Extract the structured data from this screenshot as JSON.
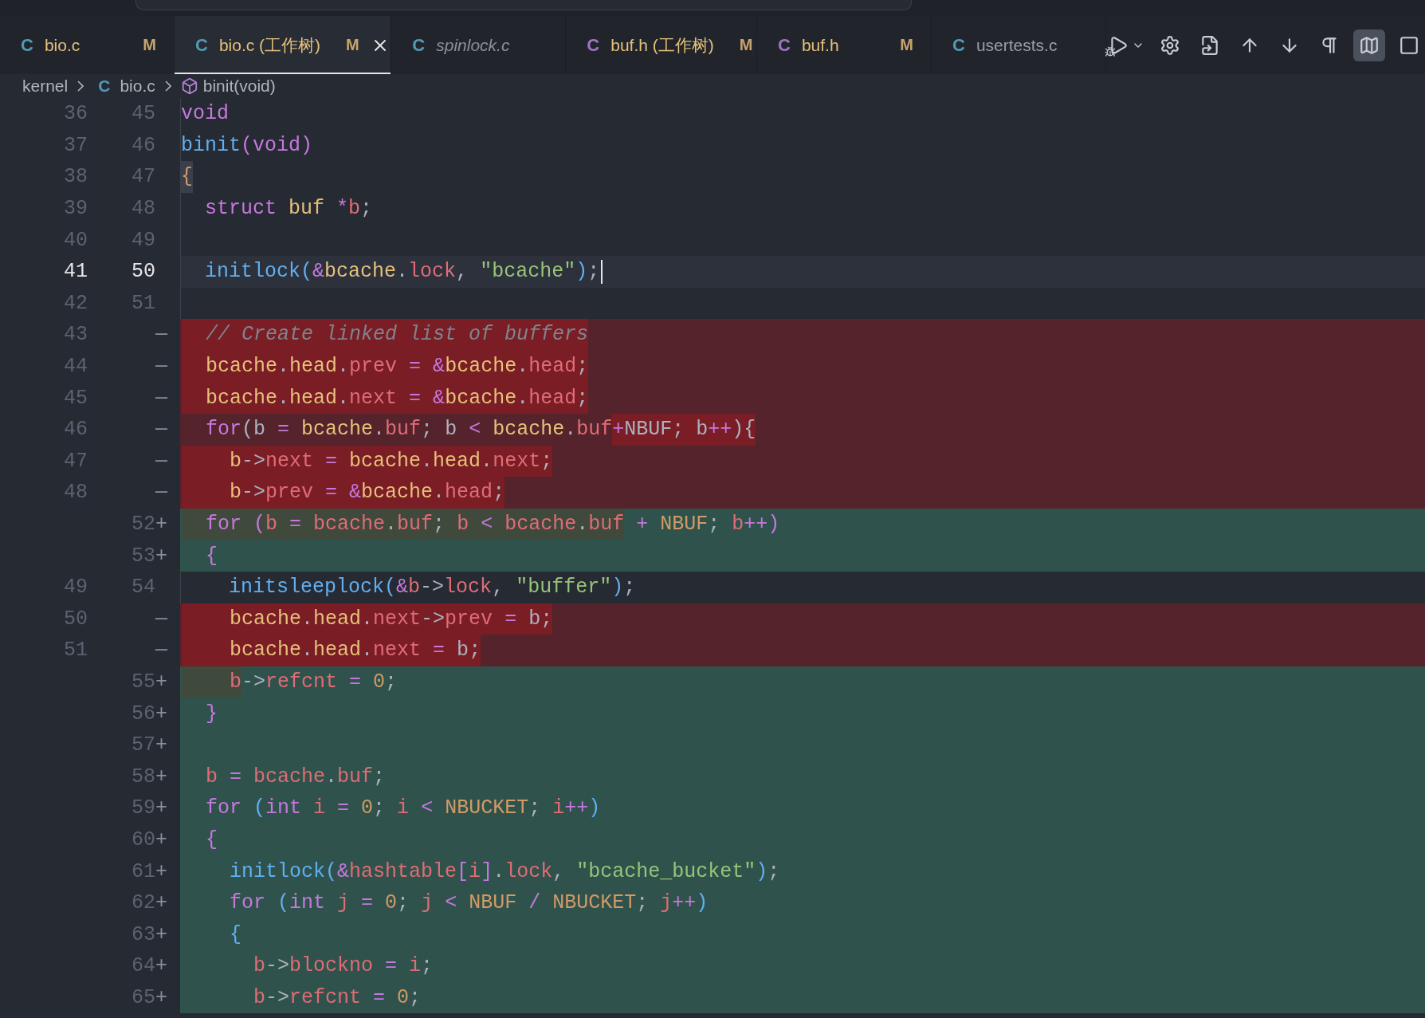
{
  "tabs": [
    {
      "icon": "C",
      "color": "#519aba",
      "label": "bio.c",
      "status": "M",
      "selected": false,
      "preview": false
    },
    {
      "icon": "C",
      "color": "#519aba",
      "label": "bio.c (工作树)",
      "status": "M",
      "selected": true,
      "preview": false
    },
    {
      "icon": "C",
      "color": "#519aba",
      "label": "spinlock.c",
      "selected": false,
      "preview": true
    },
    {
      "icon": "C",
      "color": "#a074c4",
      "label": "buf.h (工作树)",
      "status": "M",
      "selected": false,
      "preview": false
    },
    {
      "icon": "C",
      "color": "#a074c4",
      "label": "buf.h",
      "status": "M",
      "selected": false,
      "preview": false
    },
    {
      "icon": "C",
      "color": "#519aba",
      "label": "usertests.c",
      "selected": false,
      "preview": false
    }
  ],
  "toolbar": [
    {
      "kind": "run",
      "active": false
    },
    {
      "kind": "settings",
      "active": false
    },
    {
      "kind": "open-file",
      "active": false
    },
    {
      "kind": "up",
      "active": false
    },
    {
      "kind": "down",
      "active": false
    },
    {
      "kind": "whitespace",
      "active": false
    },
    {
      "kind": "map",
      "active": true
    },
    {
      "kind": "more",
      "active": false
    }
  ],
  "breadcrumb": [
    {
      "kind": "folder",
      "label": "kernel"
    },
    {
      "kind": "file",
      "icon": "C",
      "label": "bio.c"
    },
    {
      "kind": "symbol",
      "label": "binit(void)"
    }
  ],
  "rows": [
    {
      "kind": "context",
      "old": "36",
      "new": "45",
      "current": false,
      "segments": [
        {
          "hl": false,
          "tokens": [
            {
              "t": "void",
              "kind": "kw"
            }
          ]
        }
      ]
    },
    {
      "kind": "context",
      "old": "37",
      "new": "46",
      "current": false,
      "segments": [
        {
          "hl": false,
          "tokens": [
            {
              "t": "binit",
              "kind": "fn"
            },
            {
              "t": "(",
              "kind": "kw"
            },
            {
              "t": "void",
              "kind": "kw"
            },
            {
              "t": ")",
              "kind": "kw"
            }
          ]
        }
      ]
    },
    {
      "kind": "context",
      "old": "38",
      "new": "47",
      "current": false,
      "segments": [
        {
          "hl": true,
          "tokens": [
            {
              "t": "{",
              "kind": "num"
            }
          ]
        }
      ]
    },
    {
      "kind": "context",
      "old": "39",
      "new": "48",
      "current": false,
      "segments": [
        {
          "hl": false,
          "tokens": [
            {
              "t": "  struct ",
              "kind": "kw"
            },
            {
              "t": "buf",
              "kind": "obj"
            },
            {
              "t": " *",
              "kind": "kw"
            },
            {
              "t": "b",
              "kind": "var"
            },
            {
              "t": ";",
              "kind": "p"
            }
          ]
        }
      ]
    },
    {
      "kind": "context",
      "old": "40",
      "new": "49",
      "current": false,
      "segments": []
    },
    {
      "kind": "context",
      "old": "41",
      "new": "50",
      "current": true,
      "segments": [
        {
          "hl": false,
          "tokens": [
            {
              "t": "  initlock",
              "kind": "fn"
            },
            {
              "t": "(",
              "kind": "fn"
            },
            {
              "t": "&",
              "kind": "kw"
            },
            {
              "t": "bcache",
              "kind": "obj"
            },
            {
              "t": ".",
              "kind": "p"
            },
            {
              "t": "lock",
              "kind": "var"
            },
            {
              "t": ", ",
              "kind": "p"
            },
            {
              "t": "\"bcache\"",
              "kind": "str"
            },
            {
              "t": ")",
              "kind": "fn"
            },
            {
              "t": ";",
              "kind": "p"
            }
          ]
        }
      ]
    },
    {
      "kind": "context",
      "old": "42",
      "new": "51",
      "current": false,
      "segments": []
    },
    {
      "kind": "removed",
      "old": "43",
      "sign": "—",
      "current": false,
      "segments": [
        {
          "hl": true,
          "tokens": [
            {
              "t": "  // Create linked list of buffers",
              "kind": "cm"
            }
          ]
        }
      ]
    },
    {
      "kind": "removed",
      "old": "44",
      "sign": "—",
      "current": false,
      "segments": [
        {
          "hl": true,
          "tokens": [
            {
              "t": "  bcache",
              "kind": "obj"
            },
            {
              "t": ".",
              "kind": "p"
            },
            {
              "t": "head",
              "kind": "obj"
            },
            {
              "t": ".",
              "kind": "p"
            },
            {
              "t": "prev",
              "kind": "var"
            },
            {
              "t": " = ",
              "kind": "kw"
            },
            {
              "t": "&",
              "kind": "kw"
            },
            {
              "t": "bcache",
              "kind": "obj"
            },
            {
              "t": ".",
              "kind": "p"
            },
            {
              "t": "head",
              "kind": "var"
            },
            {
              "t": ";",
              "kind": "p"
            }
          ]
        }
      ]
    },
    {
      "kind": "removed",
      "old": "45",
      "sign": "—",
      "current": false,
      "segments": [
        {
          "hl": true,
          "tokens": [
            {
              "t": "  bcache",
              "kind": "obj"
            },
            {
              "t": ".",
              "kind": "p"
            },
            {
              "t": "head",
              "kind": "obj"
            },
            {
              "t": ".",
              "kind": "p"
            },
            {
              "t": "next",
              "kind": "var"
            },
            {
              "t": " = ",
              "kind": "kw"
            },
            {
              "t": "&",
              "kind": "kw"
            },
            {
              "t": "bcache",
              "kind": "obj"
            },
            {
              "t": ".",
              "kind": "p"
            },
            {
              "t": "head",
              "kind": "var"
            },
            {
              "t": ";",
              "kind": "p"
            }
          ]
        }
      ]
    },
    {
      "kind": "removed",
      "old": "46",
      "sign": "—",
      "current": false,
      "segments": [
        {
          "hl": false,
          "tokens": [
            {
              "t": "  for",
              "kind": "kw"
            },
            {
              "t": "(",
              "kind": "p"
            },
            {
              "t": "b",
              "kind": "p"
            },
            {
              "t": " = ",
              "kind": "kw"
            },
            {
              "t": "bcache",
              "kind": "obj"
            },
            {
              "t": ".",
              "kind": "p"
            },
            {
              "t": "buf",
              "kind": "var"
            },
            {
              "t": "; ",
              "kind": "p"
            },
            {
              "t": "b",
              "kind": "p"
            },
            {
              "t": " < ",
              "kind": "kw"
            },
            {
              "t": "bcache",
              "kind": "obj"
            },
            {
              "t": ".",
              "kind": "p"
            },
            {
              "t": "buf",
              "kind": "var"
            }
          ]
        },
        {
          "hl": true,
          "tokens": [
            {
              "t": "+",
              "kind": "kw"
            },
            {
              "t": "NBUF",
              "kind": "p"
            },
            {
              "t": "; ",
              "kind": "p"
            },
            {
              "t": "b",
              "kind": "p"
            },
            {
              "t": "++",
              "kind": "kw"
            },
            {
              "t": "){",
              "kind": "p"
            }
          ]
        }
      ]
    },
    {
      "kind": "removed",
      "old": "47",
      "sign": "—",
      "current": false,
      "segments": [
        {
          "hl": true,
          "tokens": [
            {
              "t": "    b",
              "kind": "obj"
            },
            {
              "t": "->",
              "kind": "p"
            },
            {
              "t": "next",
              "kind": "var"
            },
            {
              "t": " = ",
              "kind": "kw"
            },
            {
              "t": "bcache",
              "kind": "obj"
            },
            {
              "t": ".",
              "kind": "p"
            },
            {
              "t": "head",
              "kind": "obj"
            },
            {
              "t": ".",
              "kind": "p"
            },
            {
              "t": "next",
              "kind": "var"
            },
            {
              "t": ";",
              "kind": "p"
            }
          ]
        }
      ]
    },
    {
      "kind": "removed",
      "old": "48",
      "sign": "—",
      "current": false,
      "segments": [
        {
          "hl": true,
          "tokens": [
            {
              "t": "    b",
              "kind": "obj"
            },
            {
              "t": "->",
              "kind": "p"
            },
            {
              "t": "prev",
              "kind": "var"
            },
            {
              "t": " = ",
              "kind": "kw"
            },
            {
              "t": "&",
              "kind": "kw"
            },
            {
              "t": "bcache",
              "kind": "obj"
            },
            {
              "t": ".",
              "kind": "p"
            },
            {
              "t": "head",
              "kind": "var"
            },
            {
              "t": ";",
              "kind": "p"
            }
          ]
        }
      ]
    },
    {
      "kind": "added",
      "new": "52",
      "sign": "+",
      "current": false,
      "segments": [
        {
          "hl": true,
          "tokens": [
            {
              "t": "  for",
              "kind": "kw"
            }
          ]
        },
        {
          "hl": true,
          "tokens": [
            {
              "t": " (",
              "kind": "kw"
            },
            {
              "t": "b",
              "kind": "var"
            },
            {
              "t": " = ",
              "kind": "kw"
            },
            {
              "t": "bcache",
              "kind": "var"
            },
            {
              "t": ".",
              "kind": "p"
            },
            {
              "t": "buf",
              "kind": "var"
            },
            {
              "t": "; ",
              "kind": "p"
            },
            {
              "t": "b",
              "kind": "var"
            },
            {
              "t": " < ",
              "kind": "kw"
            },
            {
              "t": "bcache",
              "kind": "var"
            },
            {
              "t": ".",
              "kind": "p"
            },
            {
              "t": "buf",
              "kind": "var"
            }
          ]
        },
        {
          "hl": false,
          "tokens": [
            {
              "t": " + ",
              "kind": "kw"
            },
            {
              "t": "NBUF",
              "kind": "num"
            },
            {
              "t": "; ",
              "kind": "p"
            },
            {
              "t": "b",
              "kind": "var"
            },
            {
              "t": "++",
              "kind": "kw"
            },
            {
              "t": ")",
              "kind": "kw"
            }
          ]
        }
      ]
    },
    {
      "kind": "added",
      "new": "53",
      "sign": "+",
      "current": false,
      "segments": [
        {
          "hl": false,
          "tokens": [
            {
              "t": "  {",
              "kind": "kw"
            }
          ]
        }
      ]
    },
    {
      "kind": "context",
      "old": "49",
      "new": "54",
      "current": false,
      "segments": [
        {
          "hl": false,
          "tokens": [
            {
              "t": "    initsleeplock",
              "kind": "fn"
            },
            {
              "t": "(",
              "kind": "fn"
            },
            {
              "t": "&",
              "kind": "kw"
            },
            {
              "t": "b",
              "kind": "var"
            },
            {
              "t": "->",
              "kind": "p"
            },
            {
              "t": "lock",
              "kind": "var"
            },
            {
              "t": ", ",
              "kind": "p"
            },
            {
              "t": "\"buffer\"",
              "kind": "str"
            },
            {
              "t": ")",
              "kind": "fn"
            },
            {
              "t": ";",
              "kind": "p"
            }
          ]
        }
      ]
    },
    {
      "kind": "removed",
      "old": "50",
      "sign": "—",
      "current": false,
      "segments": [
        {
          "hl": true,
          "tokens": [
            {
              "t": "    bcache",
              "kind": "obj"
            },
            {
              "t": ".",
              "kind": "p"
            },
            {
              "t": "head",
              "kind": "obj"
            },
            {
              "t": ".",
              "kind": "p"
            },
            {
              "t": "next",
              "kind": "var"
            },
            {
              "t": "->",
              "kind": "p"
            },
            {
              "t": "prev",
              "kind": "var"
            },
            {
              "t": " = ",
              "kind": "kw"
            },
            {
              "t": "b",
              "kind": "p"
            },
            {
              "t": ";",
              "kind": "p"
            }
          ]
        }
      ]
    },
    {
      "kind": "removed",
      "old": "51",
      "sign": "—",
      "current": false,
      "segments": [
        {
          "hl": true,
          "tokens": [
            {
              "t": "    bcache",
              "kind": "obj"
            },
            {
              "t": ".",
              "kind": "p"
            },
            {
              "t": "head",
              "kind": "obj"
            },
            {
              "t": ".",
              "kind": "p"
            },
            {
              "t": "next",
              "kind": "var"
            },
            {
              "t": " = ",
              "kind": "kw"
            },
            {
              "t": "b",
              "kind": "p"
            },
            {
              "t": ";",
              "kind": "p"
            }
          ]
        }
      ]
    },
    {
      "kind": "added",
      "new": "55",
      "sign": "+",
      "current": false,
      "segments": [
        {
          "hl": true,
          "tokens": [
            {
              "t": "    b",
              "kind": "var"
            }
          ]
        },
        {
          "hl": false,
          "tokens": [
            {
              "t": "->",
              "kind": "p"
            },
            {
              "t": "refcnt",
              "kind": "var"
            },
            {
              "t": " = ",
              "kind": "kw"
            },
            {
              "t": "0",
              "kind": "num"
            },
            {
              "t": ";",
              "kind": "p"
            }
          ]
        }
      ]
    },
    {
      "kind": "added",
      "new": "56",
      "sign": "+",
      "current": false,
      "segments": [
        {
          "hl": false,
          "tokens": [
            {
              "t": "  }",
              "kind": "kw"
            }
          ]
        }
      ]
    },
    {
      "kind": "added",
      "new": "57",
      "sign": "+",
      "current": false,
      "segments": []
    },
    {
      "kind": "added",
      "new": "58",
      "sign": "+",
      "current": false,
      "segments": [
        {
          "hl": false,
          "tokens": [
            {
              "t": "  b",
              "kind": "var"
            },
            {
              "t": " = ",
              "kind": "kw"
            },
            {
              "t": "bcache",
              "kind": "var"
            },
            {
              "t": ".",
              "kind": "p"
            },
            {
              "t": "buf",
              "kind": "var"
            },
            {
              "t": ";",
              "kind": "p"
            }
          ]
        }
      ]
    },
    {
      "kind": "added",
      "new": "59",
      "sign": "+",
      "current": false,
      "segments": [
        {
          "hl": false,
          "tokens": [
            {
              "t": "  for ",
              "kind": "kw"
            },
            {
              "t": "(",
              "kind": "fn"
            },
            {
              "t": "int ",
              "kind": "kw"
            },
            {
              "t": "i",
              "kind": "var"
            },
            {
              "t": " = ",
              "kind": "kw"
            },
            {
              "t": "0",
              "kind": "num"
            },
            {
              "t": "; ",
              "kind": "p"
            },
            {
              "t": "i",
              "kind": "var"
            },
            {
              "t": " < ",
              "kind": "kw"
            },
            {
              "t": "NBUCKET",
              "kind": "num"
            },
            {
              "t": "; ",
              "kind": "p"
            },
            {
              "t": "i",
              "kind": "var"
            },
            {
              "t": "++",
              "kind": "kw"
            },
            {
              "t": ")",
              "kind": "fn"
            }
          ]
        }
      ]
    },
    {
      "kind": "added",
      "new": "60",
      "sign": "+",
      "current": false,
      "segments": [
        {
          "hl": false,
          "tokens": [
            {
              "t": "  {",
              "kind": "kw"
            }
          ]
        }
      ]
    },
    {
      "kind": "added",
      "new": "61",
      "sign": "+",
      "current": false,
      "segments": [
        {
          "hl": false,
          "tokens": [
            {
              "t": "    initlock",
              "kind": "fn"
            },
            {
              "t": "(",
              "kind": "fn"
            },
            {
              "t": "&",
              "kind": "kw"
            },
            {
              "t": "hashtable",
              "kind": "var"
            },
            {
              "t": "[",
              "kind": "kw"
            },
            {
              "t": "i",
              "kind": "var"
            },
            {
              "t": "]",
              "kind": "kw"
            },
            {
              "t": ".",
              "kind": "p"
            },
            {
              "t": "lock",
              "kind": "var"
            },
            {
              "t": ", ",
              "kind": "p"
            },
            {
              "t": "\"bcache_bucket\"",
              "kind": "str"
            },
            {
              "t": ")",
              "kind": "fn"
            },
            {
              "t": ";",
              "kind": "p"
            }
          ]
        }
      ]
    },
    {
      "kind": "added",
      "new": "62",
      "sign": "+",
      "current": false,
      "segments": [
        {
          "hl": false,
          "tokens": [
            {
              "t": "    for ",
              "kind": "kw"
            },
            {
              "t": "(",
              "kind": "fn"
            },
            {
              "t": "int ",
              "kind": "kw"
            },
            {
              "t": "j",
              "kind": "var"
            },
            {
              "t": " = ",
              "kind": "kw"
            },
            {
              "t": "0",
              "kind": "num"
            },
            {
              "t": "; ",
              "kind": "p"
            },
            {
              "t": "j",
              "kind": "var"
            },
            {
              "t": " < ",
              "kind": "kw"
            },
            {
              "t": "NBUF",
              "kind": "num"
            },
            {
              "t": " / ",
              "kind": "kw"
            },
            {
              "t": "NBUCKET",
              "kind": "num"
            },
            {
              "t": "; ",
              "kind": "p"
            },
            {
              "t": "j",
              "kind": "var"
            },
            {
              "t": "++",
              "kind": "kw"
            },
            {
              "t": ")",
              "kind": "fn"
            }
          ]
        }
      ]
    },
    {
      "kind": "added",
      "new": "63",
      "sign": "+",
      "current": false,
      "segments": [
        {
          "hl": false,
          "tokens": [
            {
              "t": "    {",
              "kind": "fn"
            }
          ]
        }
      ]
    },
    {
      "kind": "added",
      "new": "64",
      "sign": "+",
      "current": false,
      "segments": [
        {
          "hl": false,
          "tokens": [
            {
              "t": "      b",
              "kind": "var"
            },
            {
              "t": "->",
              "kind": "p"
            },
            {
              "t": "blockno",
              "kind": "var"
            },
            {
              "t": " = ",
              "kind": "kw"
            },
            {
              "t": "i",
              "kind": "var"
            },
            {
              "t": ";",
              "kind": "p"
            }
          ]
        }
      ]
    },
    {
      "kind": "added",
      "new": "65",
      "sign": "+",
      "current": false,
      "segments": [
        {
          "hl": false,
          "tokens": [
            {
              "t": "      b",
              "kind": "var"
            },
            {
              "t": "->",
              "kind": "p"
            },
            {
              "t": "refcnt",
              "kind": "var"
            },
            {
              "t": " = ",
              "kind": "kw"
            },
            {
              "t": "0",
              "kind": "num"
            },
            {
              "t": ";",
              "kind": "p"
            }
          ]
        }
      ]
    }
  ]
}
